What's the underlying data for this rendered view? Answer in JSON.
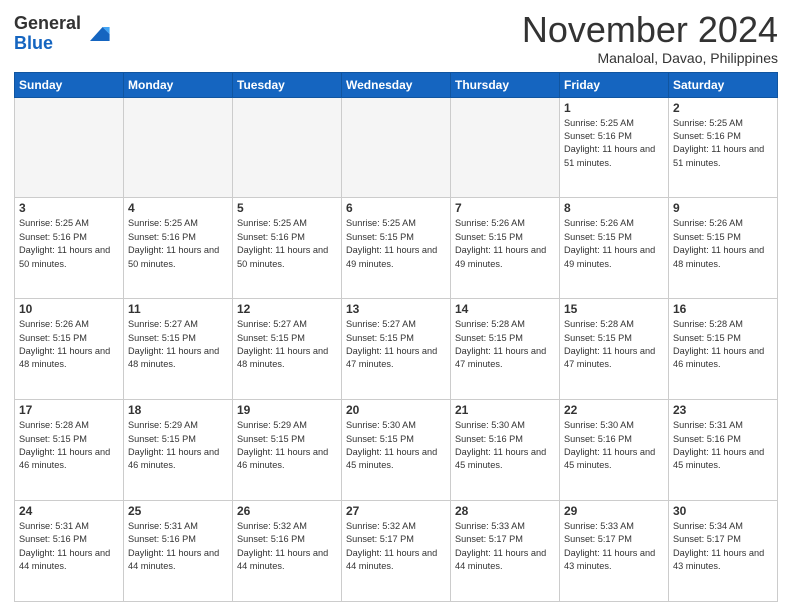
{
  "header": {
    "logo_line1": "General",
    "logo_line2": "Blue",
    "month": "November 2024",
    "location": "Manaloal, Davao, Philippines"
  },
  "weekdays": [
    "Sunday",
    "Monday",
    "Tuesday",
    "Wednesday",
    "Thursday",
    "Friday",
    "Saturday"
  ],
  "weeks": [
    [
      {
        "day": "",
        "empty": true
      },
      {
        "day": "",
        "empty": true
      },
      {
        "day": "",
        "empty": true
      },
      {
        "day": "",
        "empty": true
      },
      {
        "day": "",
        "empty": true
      },
      {
        "day": "1",
        "sunrise": "Sunrise: 5:25 AM",
        "sunset": "Sunset: 5:16 PM",
        "daylight": "Daylight: 11 hours and 51 minutes."
      },
      {
        "day": "2",
        "sunrise": "Sunrise: 5:25 AM",
        "sunset": "Sunset: 5:16 PM",
        "daylight": "Daylight: 11 hours and 51 minutes."
      }
    ],
    [
      {
        "day": "3",
        "sunrise": "Sunrise: 5:25 AM",
        "sunset": "Sunset: 5:16 PM",
        "daylight": "Daylight: 11 hours and 50 minutes."
      },
      {
        "day": "4",
        "sunrise": "Sunrise: 5:25 AM",
        "sunset": "Sunset: 5:16 PM",
        "daylight": "Daylight: 11 hours and 50 minutes."
      },
      {
        "day": "5",
        "sunrise": "Sunrise: 5:25 AM",
        "sunset": "Sunset: 5:16 PM",
        "daylight": "Daylight: 11 hours and 50 minutes."
      },
      {
        "day": "6",
        "sunrise": "Sunrise: 5:25 AM",
        "sunset": "Sunset: 5:15 PM",
        "daylight": "Daylight: 11 hours and 49 minutes."
      },
      {
        "day": "7",
        "sunrise": "Sunrise: 5:26 AM",
        "sunset": "Sunset: 5:15 PM",
        "daylight": "Daylight: 11 hours and 49 minutes."
      },
      {
        "day": "8",
        "sunrise": "Sunrise: 5:26 AM",
        "sunset": "Sunset: 5:15 PM",
        "daylight": "Daylight: 11 hours and 49 minutes."
      },
      {
        "day": "9",
        "sunrise": "Sunrise: 5:26 AM",
        "sunset": "Sunset: 5:15 PM",
        "daylight": "Daylight: 11 hours and 48 minutes."
      }
    ],
    [
      {
        "day": "10",
        "sunrise": "Sunrise: 5:26 AM",
        "sunset": "Sunset: 5:15 PM",
        "daylight": "Daylight: 11 hours and 48 minutes."
      },
      {
        "day": "11",
        "sunrise": "Sunrise: 5:27 AM",
        "sunset": "Sunset: 5:15 PM",
        "daylight": "Daylight: 11 hours and 48 minutes."
      },
      {
        "day": "12",
        "sunrise": "Sunrise: 5:27 AM",
        "sunset": "Sunset: 5:15 PM",
        "daylight": "Daylight: 11 hours and 48 minutes."
      },
      {
        "day": "13",
        "sunrise": "Sunrise: 5:27 AM",
        "sunset": "Sunset: 5:15 PM",
        "daylight": "Daylight: 11 hours and 47 minutes."
      },
      {
        "day": "14",
        "sunrise": "Sunrise: 5:28 AM",
        "sunset": "Sunset: 5:15 PM",
        "daylight": "Daylight: 11 hours and 47 minutes."
      },
      {
        "day": "15",
        "sunrise": "Sunrise: 5:28 AM",
        "sunset": "Sunset: 5:15 PM",
        "daylight": "Daylight: 11 hours and 47 minutes."
      },
      {
        "day": "16",
        "sunrise": "Sunrise: 5:28 AM",
        "sunset": "Sunset: 5:15 PM",
        "daylight": "Daylight: 11 hours and 46 minutes."
      }
    ],
    [
      {
        "day": "17",
        "sunrise": "Sunrise: 5:28 AM",
        "sunset": "Sunset: 5:15 PM",
        "daylight": "Daylight: 11 hours and 46 minutes."
      },
      {
        "day": "18",
        "sunrise": "Sunrise: 5:29 AM",
        "sunset": "Sunset: 5:15 PM",
        "daylight": "Daylight: 11 hours and 46 minutes."
      },
      {
        "day": "19",
        "sunrise": "Sunrise: 5:29 AM",
        "sunset": "Sunset: 5:15 PM",
        "daylight": "Daylight: 11 hours and 46 minutes."
      },
      {
        "day": "20",
        "sunrise": "Sunrise: 5:30 AM",
        "sunset": "Sunset: 5:15 PM",
        "daylight": "Daylight: 11 hours and 45 minutes."
      },
      {
        "day": "21",
        "sunrise": "Sunrise: 5:30 AM",
        "sunset": "Sunset: 5:16 PM",
        "daylight": "Daylight: 11 hours and 45 minutes."
      },
      {
        "day": "22",
        "sunrise": "Sunrise: 5:30 AM",
        "sunset": "Sunset: 5:16 PM",
        "daylight": "Daylight: 11 hours and 45 minutes."
      },
      {
        "day": "23",
        "sunrise": "Sunrise: 5:31 AM",
        "sunset": "Sunset: 5:16 PM",
        "daylight": "Daylight: 11 hours and 45 minutes."
      }
    ],
    [
      {
        "day": "24",
        "sunrise": "Sunrise: 5:31 AM",
        "sunset": "Sunset: 5:16 PM",
        "daylight": "Daylight: 11 hours and 44 minutes."
      },
      {
        "day": "25",
        "sunrise": "Sunrise: 5:31 AM",
        "sunset": "Sunset: 5:16 PM",
        "daylight": "Daylight: 11 hours and 44 minutes."
      },
      {
        "day": "26",
        "sunrise": "Sunrise: 5:32 AM",
        "sunset": "Sunset: 5:16 PM",
        "daylight": "Daylight: 11 hours and 44 minutes."
      },
      {
        "day": "27",
        "sunrise": "Sunrise: 5:32 AM",
        "sunset": "Sunset: 5:17 PM",
        "daylight": "Daylight: 11 hours and 44 minutes."
      },
      {
        "day": "28",
        "sunrise": "Sunrise: 5:33 AM",
        "sunset": "Sunset: 5:17 PM",
        "daylight": "Daylight: 11 hours and 44 minutes."
      },
      {
        "day": "29",
        "sunrise": "Sunrise: 5:33 AM",
        "sunset": "Sunset: 5:17 PM",
        "daylight": "Daylight: 11 hours and 43 minutes."
      },
      {
        "day": "30",
        "sunrise": "Sunrise: 5:34 AM",
        "sunset": "Sunset: 5:17 PM",
        "daylight": "Daylight: 11 hours and 43 minutes."
      }
    ]
  ]
}
